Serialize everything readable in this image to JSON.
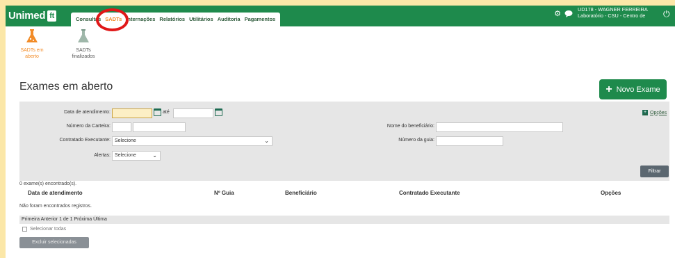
{
  "header": {
    "logo": "Unimed",
    "logo_mark": "ft",
    "tabs": [
      "Consultas",
      "SADTs",
      "Internações",
      "Relatórios",
      "Utilitários",
      "Auditoria",
      "Pagamentos"
    ],
    "active_tab": "SADTs",
    "user_line1": "UD178 - WAGNER FERREIRA",
    "user_line2": "Laboratório - CSU - Centro de",
    "icons": [
      "gear-icon",
      "chat-icon",
      "power-icon"
    ]
  },
  "subtabs": {
    "open_label_1": "SADTs em",
    "open_label_2": "aberto",
    "done_label_1": "SADTs",
    "done_label_2": "finalizados"
  },
  "page": {
    "title": "Exames em aberto",
    "new_button": "Novo Exame"
  },
  "filter": {
    "data_atendimento_label": "Data de atendimento:",
    "ate_label": "até",
    "numero_carteira_label": "Número da Carteira:",
    "contratado_label": "Contratado Executante:",
    "contratado_value": "Selecione",
    "alertas_label": "Alertas:",
    "alertas_value": "Selecione",
    "nome_beneficiario_label": "Nome do beneficiário:",
    "numero_guia_label": "Número da guia:",
    "opcoes_label": "Opções",
    "filtrar_button": "Filtrar"
  },
  "results": {
    "count_text": "0 exame(s) encontrado(s).",
    "columns": [
      "Data de atendimento",
      "Nº Guia",
      "Beneficiário",
      "Contratado Executante",
      "Opções"
    ],
    "empty_text": "Não foram encontrados registros.",
    "pager_text": "Primeira Anterior   1 de 1  Próxima Última",
    "select_all_label": "Selecionar todas",
    "delete_button": "Excluir selecionadas"
  },
  "colors": {
    "brand_green": "#1e8a4c",
    "active_orange": "#f28c28",
    "highlight_red": "#e01818",
    "background_yellow": "#fbe7a8"
  }
}
